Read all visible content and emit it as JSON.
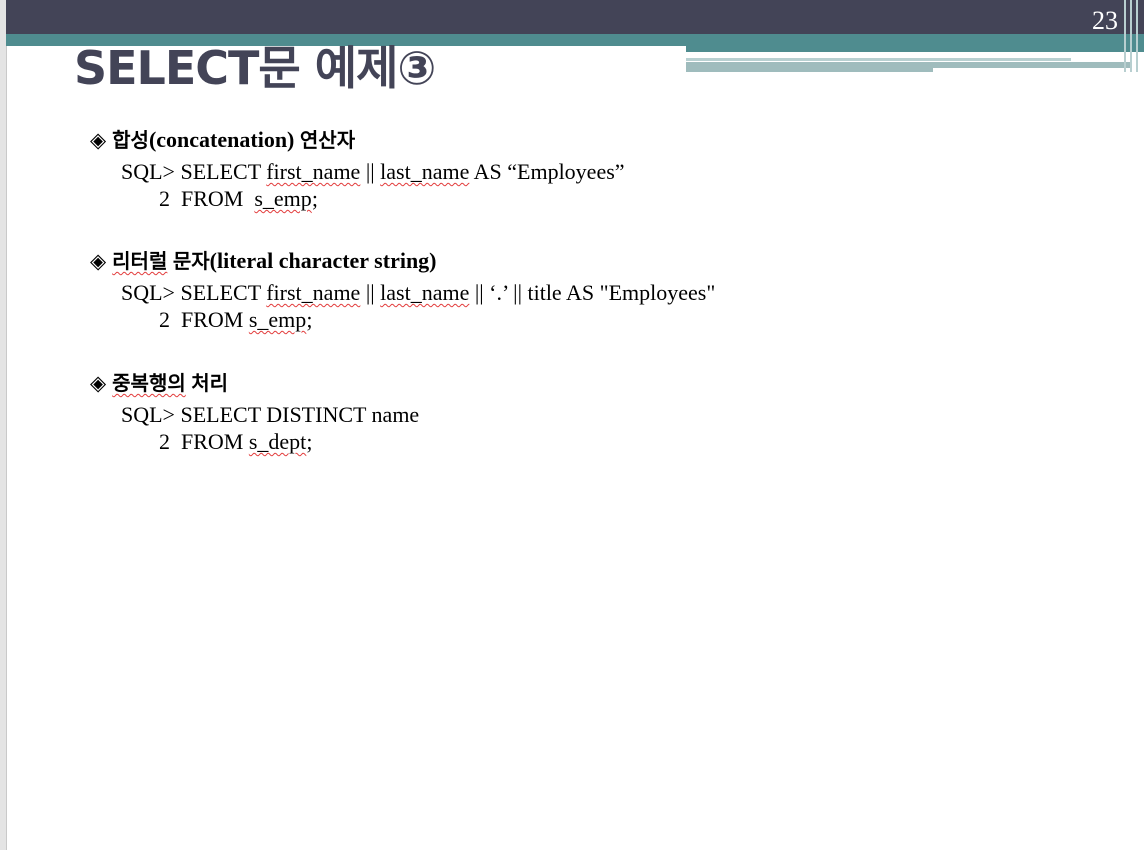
{
  "slide": {
    "number": "23",
    "title": "SELECT문 예제③"
  },
  "sections": [
    {
      "bullet": "◈",
      "heading_kor1": "합성",
      "heading_en": "(concatenation)",
      "heading_kor2": "연산자",
      "line1": {
        "prefix": "SQL> SELECT ",
        "w1": "first_name",
        "mid1": " || ",
        "w2": "last_name",
        "suffix": " AS “Employees”"
      },
      "line2": {
        "prefix": "2  FROM  ",
        "w1": "s_emp",
        "suffix": ";"
      }
    },
    {
      "bullet": "◈",
      "heading_kor1": "리터럴",
      "heading_kor2": "문자",
      "heading_en": "(literal character string)",
      "line1": {
        "prefix": "SQL> SELECT ",
        "w1": "first_name",
        "mid1": " || ",
        "w2": "last_name",
        "suffix": " || ‘.’ || title AS \"Employees\""
      },
      "line2": {
        "prefix": "2  FROM ",
        "w1": "s_emp",
        "suffix": ";"
      }
    },
    {
      "bullet": "◈",
      "heading_kor1": "중복행의",
      "heading_kor2": "처리",
      "line1": {
        "text": "SQL> SELECT DISTINCT name"
      },
      "line2": {
        "prefix": "2  FROM ",
        "w1": "s_dept",
        "suffix": ";"
      }
    }
  ]
}
